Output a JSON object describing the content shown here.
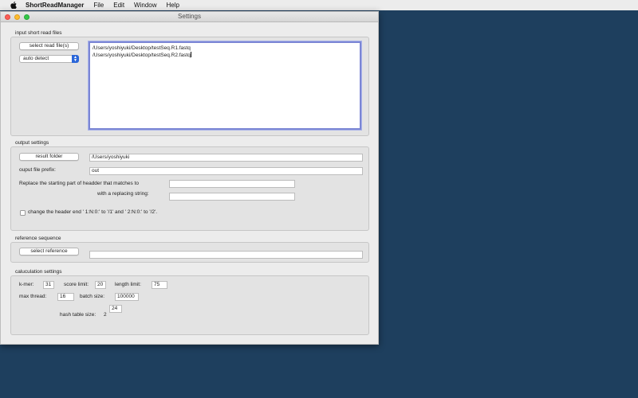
{
  "menubar": {
    "app_name": "ShortReadManager",
    "items": [
      "File",
      "Edit",
      "Window",
      "Help"
    ]
  },
  "window": {
    "title": "Settings"
  },
  "input_group": {
    "label": "input short read files",
    "select_button": "select read file(s)",
    "format_select": "auto detect",
    "files": [
      "/Users/yoshiyuki/Desktop/testSeq.R1.fastq",
      "/Users/yoshiyuki/Desktop/testSeq.R2.fastq"
    ]
  },
  "output_group": {
    "label": "output settings",
    "result_button": "result folder",
    "result_path": "/Users/yoshiyuki",
    "prefix_label": "ouput file prefix:",
    "prefix_value": "out",
    "replace_label": "Replace the starting part of headder that matches to",
    "replace_value": "",
    "with_label": "with a replacing string:",
    "with_value": "",
    "checkbox_label": "change the header end ' 1:N:0:' to '/1' and ' 2:N:0:' to '/2'.",
    "checkbox_checked": false
  },
  "reference_group": {
    "label": "reference sequence",
    "select_button": "select reference",
    "path": ""
  },
  "calc_group": {
    "label": "caluculation settings",
    "kmer_label": "k-mer:",
    "kmer_value": "31",
    "score_label": "score limit:",
    "score_value": "20",
    "length_label": "length limit:",
    "length_value": "75",
    "thread_label": "max thread:",
    "thread_value": "16",
    "batch_label": "batch size:",
    "batch_value": "100000",
    "hash_label": "hash table size:",
    "hash_base": "2",
    "hash_exp": "24"
  }
}
